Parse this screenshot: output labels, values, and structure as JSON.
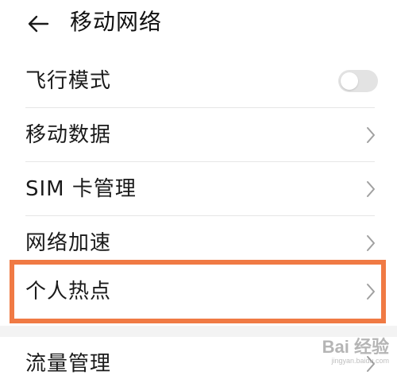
{
  "header": {
    "title": "移动网络",
    "back_icon": "back-arrow-icon"
  },
  "settings": {
    "airplane_mode": {
      "label": "飞行模式",
      "enabled": false
    },
    "mobile_data": {
      "label": "移动数据"
    },
    "sim_management": {
      "label": "SIM 卡管理"
    },
    "network_acceleration": {
      "label": "网络加速"
    },
    "personal_hotspot": {
      "label": "个人热点"
    },
    "data_usage": {
      "label": "流量管理"
    }
  },
  "colors": {
    "highlight_border": "#f07a44",
    "toggle_off": "#e3e3e3",
    "chevron": "#a0a0a0"
  },
  "watermark": {
    "brand": "Bai 经验",
    "url": "jingyan.baidu.com"
  }
}
